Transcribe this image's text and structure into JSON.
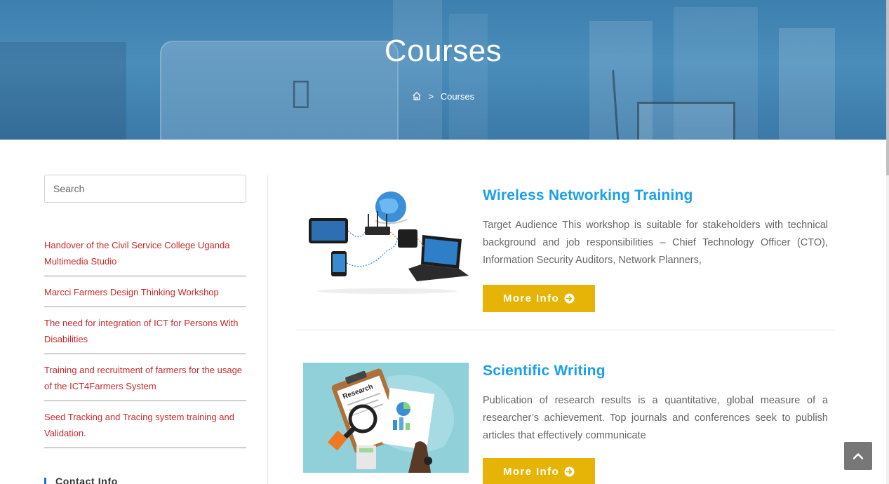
{
  "hero": {
    "title": "Courses",
    "breadcrumb": {
      "home_icon": "home-icon",
      "separator": ">",
      "current": "Courses"
    }
  },
  "sidebar": {
    "search": {
      "placeholder": "Search",
      "value": ""
    },
    "recent_posts": [
      {
        "label": "Handover of the Civil Service College Uganda Multimedia Studio"
      },
      {
        "label": "Marcci Farmers Design Thinking Workshop"
      },
      {
        "label": "The need for integration of ICT for Persons With Disabilities"
      },
      {
        "label": "Training and recruitment of farmers for the usage of the ICT4Farmers System"
      },
      {
        "label": "Seed Tracking and Tracing system training and Validation."
      }
    ],
    "contact_title": "Contact Info"
  },
  "posts": [
    {
      "title": "Wireless Networking Training",
      "excerpt": "Target Audience This workshop is suitable for stakeholders with technical background and job responsibilities – Chief Technology Officer (CTO), Information Security Auditors, Network Planners,",
      "button_label": "More Info",
      "thumbnail_icon": "network-devices-illustration"
    },
    {
      "title": "Scientific Writing",
      "excerpt": "Publication of research results is a quantitative, global measure of a researcher’s achievement. Top journals and conferences seek to publish articles that effectively communicate",
      "button_label": "More Info",
      "thumbnail_icon": "research-clipboard-illustration"
    }
  ],
  "colors": {
    "hero_overlay": "#3d7fae",
    "link_red": "#c92a2a",
    "title_blue": "#1aa0e6",
    "button_yellow": "#e6b406",
    "back_to_top": "#777777"
  },
  "back_to_top_icon": "chevron-up-icon"
}
